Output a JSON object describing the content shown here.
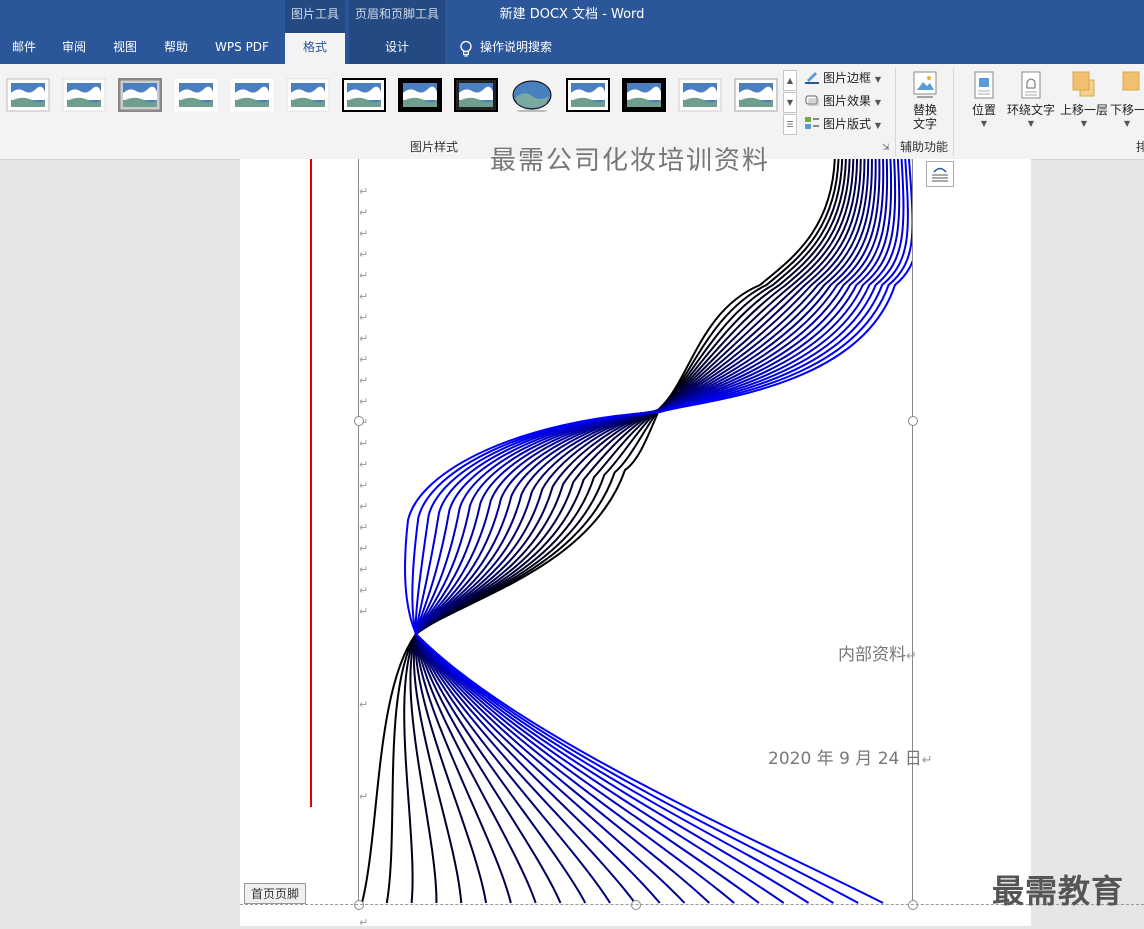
{
  "titlebar": {
    "document_title": "新建 DOCX 文档  -  Word",
    "context_picture_tools": "图片工具",
    "context_header_footer_tools": "页眉和页脚工具"
  },
  "tabs": [
    {
      "label": "邮件",
      "active": false
    },
    {
      "label": "审阅",
      "active": false
    },
    {
      "label": "视图",
      "active": false
    },
    {
      "label": "帮助",
      "active": false
    },
    {
      "label": "WPS PDF",
      "active": false
    },
    {
      "label": "格式",
      "active": true
    },
    {
      "label": "设计",
      "active": false
    }
  ],
  "tell_me": {
    "label": "操作说明搜索",
    "icon": "lightbulb-icon"
  },
  "ribbon": {
    "picture_styles": {
      "group_label": "图片样式",
      "styles": [
        "simple-frame-white",
        "soft-edge",
        "drop-shadow-gray",
        "rounded-diagonal",
        "reflected",
        "beveled",
        "simple-frame-black",
        "thick-black-frame",
        "double-frame-black",
        "oval-shadow",
        "metal-frame",
        "black-border",
        "rotated-white",
        "soft-rounded"
      ],
      "picture_border": "图片边框",
      "picture_effects": "图片效果",
      "picture_layout": "图片版式"
    },
    "accessibility": {
      "group_label": "辅助功能",
      "alt_text_line1": "替换",
      "alt_text_line2": "文字"
    },
    "arrange": {
      "position": "位置",
      "wrap_text": "环绕文字",
      "bring_forward": "上移一层",
      "send_backward": "下移一",
      "group_label_partial": "排"
    }
  },
  "document": {
    "heading_partial": "最需公司化妆培训资料",
    "internal_label": "内部资料",
    "date": "2020 年 9 月 24 日",
    "return_mark": "↵",
    "footer_tag": "首页页脚"
  },
  "watermark": "最需教育",
  "colors": {
    "title_bar": "#2b579a",
    "context_tab": "#244a84",
    "ribbon_bg": "#f3f3f3",
    "curve_black": "#000000",
    "curve_blue": "#0000ff",
    "margin_line": "#e00000"
  }
}
